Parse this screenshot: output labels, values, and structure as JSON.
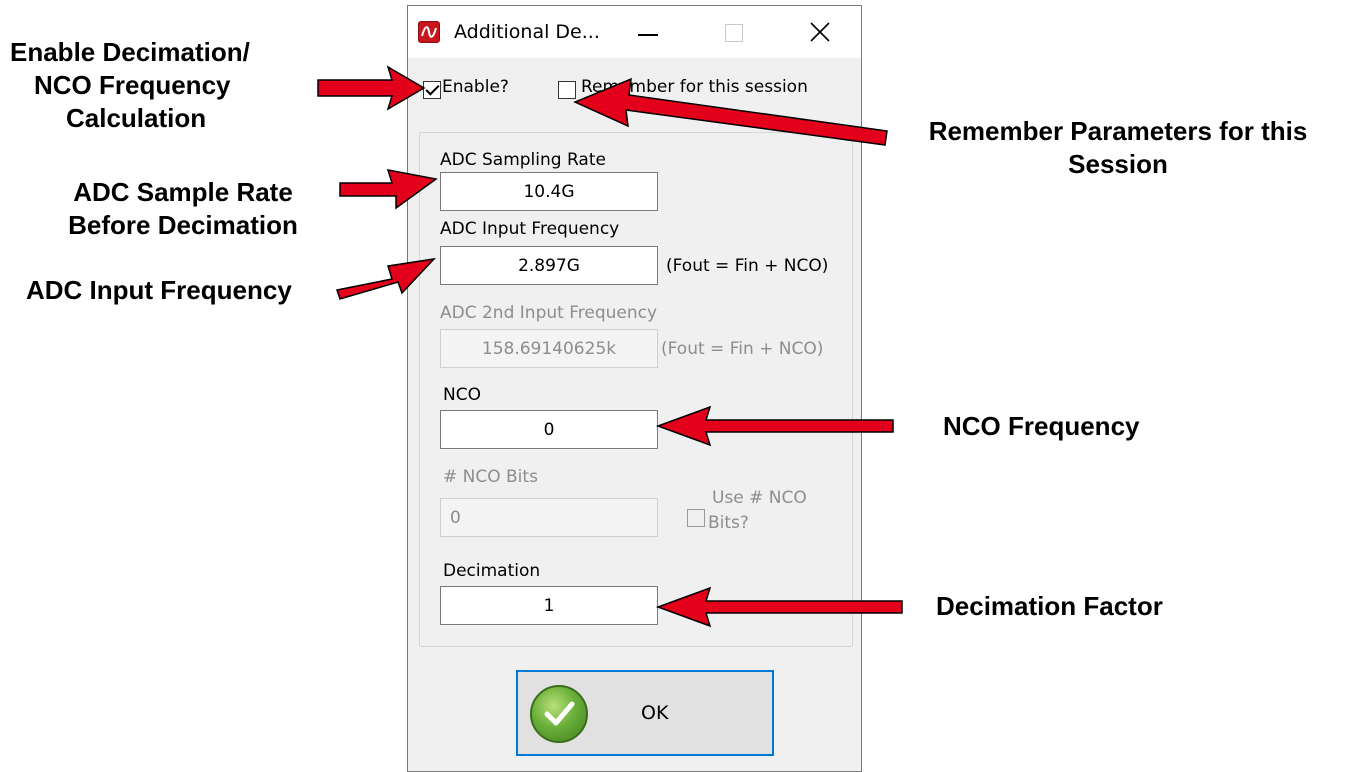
{
  "window": {
    "title": "Additional De...",
    "minimize": "minimize",
    "maximize": "maximize",
    "close": "✕"
  },
  "options": {
    "enable_label": "Enable?",
    "enable_checked": true,
    "remember_label": "Remember for this session",
    "remember_checked": false
  },
  "form": {
    "adc_sampling_rate": {
      "label": "ADC Sampling Rate",
      "value": "10.4G"
    },
    "adc_input_frequency": {
      "label": "ADC Input  Frequency",
      "value": "2.897G",
      "note": "(Fout = Fin + NCO)"
    },
    "adc_2nd_input_frequency": {
      "label": "ADC 2nd Input  Frequency",
      "value": "158.69140625k",
      "note": "(Fout = Fin + NCO)"
    },
    "nco": {
      "label": "NCO",
      "value": "0"
    },
    "nco_bits": {
      "label": "# NCO Bits",
      "value": "0",
      "checkbox_line1": "Use # NCO",
      "checkbox_line2": "Bits?"
    },
    "decimation": {
      "label": "Decimation",
      "value": "1"
    }
  },
  "ok_button": {
    "label": "OK"
  },
  "annotations": {
    "enable": [
      "Enable Decimation/",
      "NCO Frequency",
      "Calculation"
    ],
    "remember": [
      "Remember Parameters for this",
      "Session"
    ],
    "sample_rate": [
      "ADC Sample Rate",
      "Before Decimation"
    ],
    "input_freq": "ADC Input Frequency",
    "nco_freq": "NCO Frequency",
    "decimation_factor": "Decimation Factor"
  },
  "colors": {
    "arrow": "#e3001b",
    "arrow_outline": "#000000",
    "ok_border": "#0078d7",
    "app_icon": "#c8161d"
  }
}
